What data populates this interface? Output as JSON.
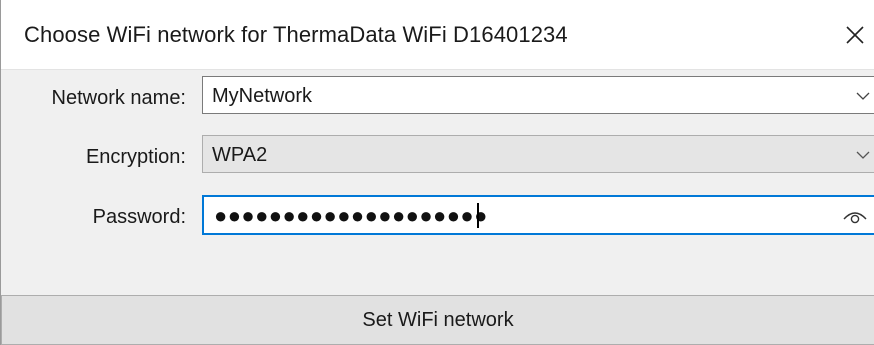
{
  "window": {
    "title": "Choose WiFi network for ThermaData WiFi D16401234"
  },
  "form": {
    "network_label": "Network name:",
    "network_value": "MyNetwork",
    "encryption_label": "Encryption:",
    "encryption_value": "WPA2",
    "password_label": "Password:",
    "password_masked": "●●●●●●●●●●●●●●●●●●●●"
  },
  "actions": {
    "set_button_label": "Set WiFi network"
  },
  "icons": {
    "close": "close-icon",
    "dropdown": "chevron-down-icon",
    "reveal": "eye-icon"
  },
  "colors": {
    "focus_border": "#0078d7",
    "disabled_field": "#e5e5e5",
    "window_bg": "#f0f0f0"
  }
}
